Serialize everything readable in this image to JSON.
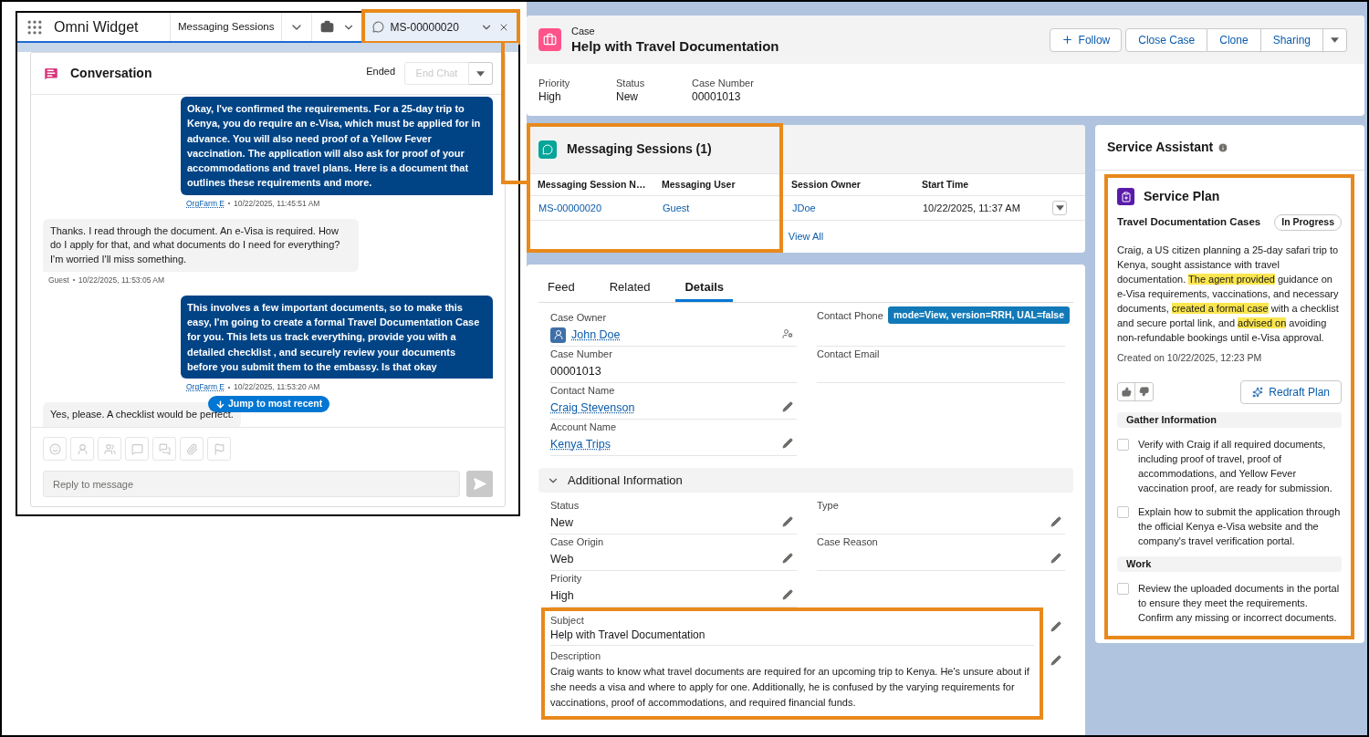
{
  "widget": {
    "title": "Omni Widget",
    "tabs": [
      {
        "kind": "list",
        "label": "Messaging Sessions",
        "selected": false,
        "callout": false
      },
      {
        "kind": "icon",
        "selected": false,
        "callout": false
      },
      {
        "kind": "record",
        "label": "MS-00000020",
        "selected": true,
        "callout": true
      }
    ],
    "conversation": {
      "title": "Conversation",
      "status": "Ended",
      "end_chat": {
        "label": "End Chat",
        "disabled": true
      },
      "messages": [
        {
          "kind": "agent",
          "text": "Okay, I've confirmed the requirements. For a 25-day trip to Kenya, you do require an e-Visa, which must be applied for in advance. You will also need proof of a Yellow Fever vaccination. The application will also ask for proof of your accommodations and travel plans. Here is a document that outlines these requirements and more.",
          "author": "OrgFarm E",
          "time": "10/22/2025, 11:45:51 AM"
        },
        {
          "kind": "guest",
          "text": "Thanks. I read through the document. An e-Visa is required. How do I apply for that, and what documents do I need for everything? I'm worried I'll miss something.",
          "author": "Guest",
          "time": "10/22/2025, 11:53:05 AM"
        },
        {
          "kind": "agent",
          "text": "This involves a few important documents, so to make this easy, I'm going to create a formal Travel Documentation Case for you. This lets us track everything, provide you with a detailed checklist , and securely review your documents before you submit them to the embassy. Is that okay",
          "author": "OrgFarm E",
          "time": "10/22/2025, 11:53:20 AM"
        },
        {
          "kind": "guest",
          "text": "Yes, please. A checklist would be perfect."
        }
      ],
      "jump_button": "Jump to most recent",
      "composer": {
        "placeholder": "Reply to message",
        "disabled": true
      }
    }
  },
  "case": {
    "object": "Case",
    "title": "Help with Travel Documentation",
    "actions": [
      {
        "kind": "follow",
        "label": "Follow"
      },
      {
        "kind": "group",
        "label": "Close Case"
      },
      {
        "kind": "group",
        "label": "Clone"
      },
      {
        "kind": "group",
        "label": "Sharing"
      },
      {
        "kind": "menu"
      }
    ],
    "highlights": [
      {
        "label": "Priority",
        "value": "High"
      },
      {
        "label": "Status",
        "value": "New"
      },
      {
        "label": "Case Number",
        "value": "00001013"
      }
    ]
  },
  "sessions": {
    "title": "Messaging Sessions (1)",
    "callout": true,
    "columns": [
      {
        "label": "Messaging Session N…",
        "kind": "link"
      },
      {
        "label": "Messaging User",
        "kind": "link"
      },
      {
        "label": "Session Owner",
        "kind": "link"
      },
      {
        "label": "Start Time",
        "kind": "text"
      }
    ],
    "rows": [
      {
        "cells": [
          "MS-00000020",
          "Guest",
          "JDoe",
          "10/22/2025, 11:37 AM"
        ]
      }
    ],
    "view_all": "View All"
  },
  "details": {
    "tabs": [
      {
        "label": "Feed",
        "selected": false
      },
      {
        "label": "Related",
        "selected": false
      },
      {
        "label": "Details",
        "selected": true
      }
    ],
    "sections": [
      {
        "rows": [
          {
            "fields": [
              {
                "label": "Case Owner",
                "value": "John Doe",
                "kind": "owner"
              },
              {
                "label": "Contact Phone",
                "kind": "text",
                "badge": "mode=View, version=RRH, UAL=false",
                "editable": false
              }
            ]
          },
          {
            "fields": [
              {
                "label": "Case Number",
                "value": "00001013",
                "kind": "text",
                "editable": false
              },
              {
                "label": "Contact Email",
                "kind": "text",
                "editable": false
              }
            ]
          },
          {
            "fields": [
              {
                "label": "Contact Name",
                "value": "Craig Stevenson",
                "kind": "link",
                "editable": true
              }
            ]
          },
          {
            "fields": [
              {
                "label": "Account Name",
                "value": "Kenya Trips",
                "kind": "link",
                "editable": true
              }
            ]
          }
        ]
      },
      {
        "title": "Additional Information",
        "expanded": true,
        "rows": [
          {
            "fields": [
              {
                "label": "Status",
                "value": "New",
                "kind": "text",
                "editable": true
              },
              {
                "label": "Type",
                "kind": "text",
                "editable": true
              }
            ]
          },
          {
            "fields": [
              {
                "label": "Case Origin",
                "value": "Web",
                "kind": "text",
                "editable": true
              },
              {
                "label": "Case Reason",
                "kind": "text",
                "editable": true
              }
            ]
          },
          {
            "fields": [
              {
                "label": "Priority",
                "value": "High",
                "kind": "text",
                "editable": true
              }
            ]
          }
        ],
        "wide_callout": true,
        "wide_fields": [
          {
            "label": "Subject",
            "value": "Help with Travel Documentation",
            "editable": true
          },
          {
            "label": "Description",
            "value": "Craig wants to know what travel documents are required for an upcoming trip to Kenya. He's unsure about if she needs a visa and where to apply for one. Additionally, he is confused by the varying requirements for vaccinations, proof of accommodations, and required financial funds.",
            "editable": true
          }
        ]
      }
    ]
  },
  "assistant": {
    "title": "Service Assistant",
    "plan": {
      "title": "Service Plan",
      "callout": true,
      "case_type": "Travel Documentation Cases",
      "status": "In Progress",
      "summary": [
        {
          "text": "Craig, a US citizen planning a 25-day safari trip to Kenya, sought assistance with travel documentation. ",
          "highlighted": false
        },
        {
          "text": "The agent provided",
          "highlighted": true
        },
        {
          "text": " guidance on e-Visa requirements, vaccinations, and necessary documents, ",
          "highlighted": false
        },
        {
          "text": "created a formal case",
          "highlighted": true
        },
        {
          "text": " with a checklist and secure portal link, and ",
          "highlighted": false
        },
        {
          "text": "advised on",
          "highlighted": true
        },
        {
          "text": " avoiding non-refundable bookings until e-Visa approval.",
          "highlighted": false
        }
      ],
      "created": "Created on 10/22/2025, 12:23 PM",
      "redraft": "Redraft Plan",
      "sections": [
        {
          "title": "Gather Information",
          "tasks": [
            {
              "text": "Verify with Craig if all required documents, including proof of travel, proof of accommodations, and Yellow Fever vaccination proof, are ready for submission.",
              "checked": false
            },
            {
              "text": "Explain how to submit the application through the official Kenya e-Visa website and the company's travel verification portal.",
              "checked": false
            }
          ]
        },
        {
          "title": "Work",
          "tasks": [
            {
              "text": "Review the uploaded documents in the portal to ensure they meet the requirements. Confirm any missing or incorrect documents.",
              "checked": false
            }
          ]
        }
      ]
    }
  }
}
